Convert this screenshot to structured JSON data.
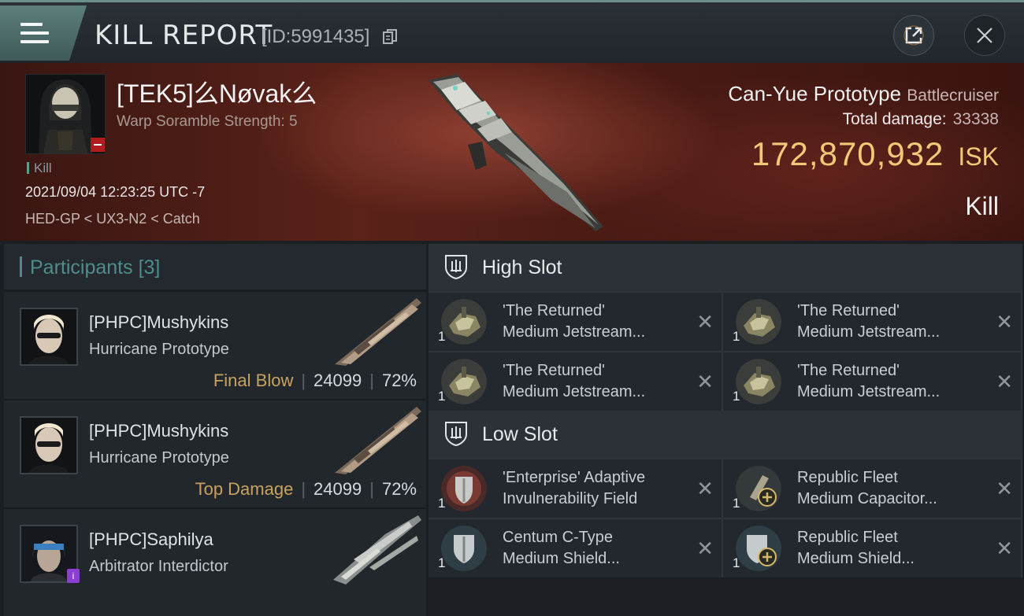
{
  "header": {
    "title": "KILL REPORT",
    "report_id": "[ID:5991435]"
  },
  "victim": {
    "name": "[TEK5]么Nøvak么",
    "warp_scramble": "Warp Soramble Strength: 5",
    "kill_tag": "Kill",
    "datetime": "2021/09/04 12:23:25 UTC -7",
    "location": "HED-GP < UX3-N2 < Catch",
    "ship_name": "Can-Yue Prototype",
    "ship_class": "Battlecruiser",
    "total_damage_label": "Total damage:",
    "total_damage": "33338",
    "isk_value": "172,870,932",
    "isk_unit": "ISK",
    "result": "Kill"
  },
  "participants": {
    "label": "Participants",
    "count": "[3]",
    "rows": [
      {
        "name": "[PHPC]Mushykins",
        "ship": "Hurricane Prototype",
        "tag": "Final Blow",
        "damage": "24099",
        "percent": "72%"
      },
      {
        "name": "[PHPC]Mushykins",
        "ship": "Hurricane Prototype",
        "tag": "Top Damage",
        "damage": "24099",
        "percent": "72%"
      },
      {
        "name": "[PHPC]Saphilya",
        "ship": "Arbitrator Interdictor",
        "tag": "",
        "damage": "",
        "percent": ""
      }
    ]
  },
  "fitting": {
    "high_slot": {
      "label": "High Slot",
      "modules": [
        {
          "qty": "1",
          "line1": "'The Returned'",
          "line2": "Medium Jetstream..."
        },
        {
          "qty": "1",
          "line1": "'The Returned'",
          "line2": "Medium Jetstream..."
        },
        {
          "qty": "1",
          "line1": "'The Returned'",
          "line2": "Medium Jetstream..."
        },
        {
          "qty": "1",
          "line1": "'The Returned'",
          "line2": "Medium Jetstream..."
        }
      ]
    },
    "low_slot": {
      "label": "Low Slot",
      "modules": [
        {
          "qty": "1",
          "line1": "'Enterprise' Adaptive",
          "line2": "Invulnerability Field"
        },
        {
          "qty": "1",
          "line1": "Republic Fleet",
          "line2": "Medium Capacitor..."
        },
        {
          "qty": "1",
          "line1": "Centum C-Type",
          "line2": "Medium Shield..."
        },
        {
          "qty": "1",
          "line1": "Republic Fleet",
          "line2": "Medium Shield..."
        }
      ]
    },
    "remove_glyph": "✕"
  },
  "colors": {
    "accent_teal": "#4f8c89",
    "isk_gold": "#f2c879",
    "tag_gold": "#c9a260",
    "banner_red": "#5a2219"
  }
}
